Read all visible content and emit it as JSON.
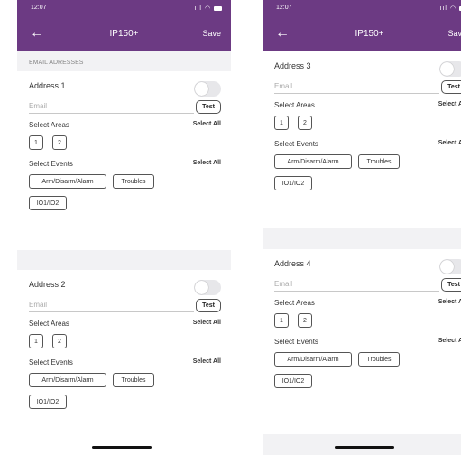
{
  "status": {
    "time": "12:07"
  },
  "nav": {
    "back_icon": "arrow-left-icon",
    "title": "IP150+",
    "save_label": "Save"
  },
  "section_header": "EMAIL ADRESSES",
  "common": {
    "email_placeholder": "Email",
    "test_label": "Test",
    "select_areas_label": "Select Areas",
    "select_events_label": "Select Events",
    "select_all_label": "Select All",
    "areas": [
      "1",
      "2"
    ],
    "events": [
      "Arm/Disarm/Alarm",
      "Troubles",
      "IO1/IO2"
    ]
  },
  "addresses": [
    {
      "label": "Address 1",
      "enabled": false
    },
    {
      "label": "Address 2",
      "enabled": false
    },
    {
      "label": "Address 3",
      "enabled": false
    },
    {
      "label": "Address 4",
      "enabled": false
    }
  ],
  "colors": {
    "header_purple": "#6c3a83",
    "background_gray": "#f2f2f4"
  }
}
